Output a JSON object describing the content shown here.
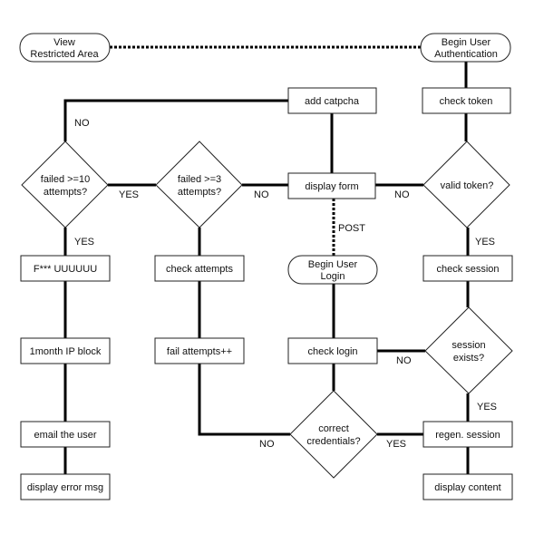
{
  "nodes": {
    "view_restricted": [
      "View",
      "Restricted Area"
    ],
    "begin_auth": [
      "Begin User",
      "Authentication"
    ],
    "add_captcha": "add catpcha",
    "check_token": "check token",
    "failed10": [
      "failed >=10",
      "attempts?"
    ],
    "failed3": [
      "failed >=3",
      "attempts?"
    ],
    "display_form": "display form",
    "valid_token": "valid token?",
    "fuuu": "F*** UUUUUU",
    "check_attempts": "check attempts",
    "begin_login": [
      "Begin User",
      "Login"
    ],
    "check_session": "check session",
    "ip_block": "1month IP block",
    "fail_attempts": "fail attempts++",
    "check_login": "check login",
    "session_exists": [
      "session",
      "exists?"
    ],
    "email_user": "email the user",
    "correct_credentials": [
      "correct",
      "credentials?"
    ],
    "regen_session": "regen. session",
    "display_error": "display error msg",
    "display_content": "display content"
  },
  "edge_labels": {
    "failed10_no": "NO",
    "failed10_yes_right": "YES",
    "failed3_no": "NO",
    "failed10_yes_down": "YES",
    "valid_token_no": "NO",
    "post": "POST",
    "valid_token_yes": "YES",
    "session_no": "NO",
    "session_yes": "YES",
    "credentials_no": "NO",
    "credentials_yes": "YES"
  }
}
